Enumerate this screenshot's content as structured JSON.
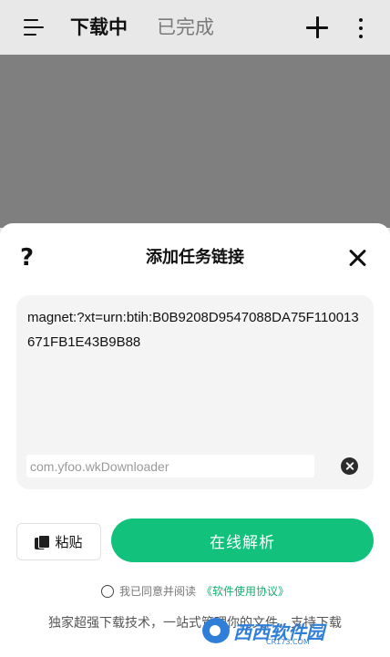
{
  "app_bar": {
    "tabs": [
      {
        "label": "下载中",
        "active": true
      },
      {
        "label": "已完成",
        "active": false
      }
    ]
  },
  "dialog": {
    "help_label": "?",
    "title": "添加任务链接",
    "link_value": "magnet:?xt=urn:btih:B0B9208D9547088DA75F110013671FB1E43B9B88",
    "package_value": "com.yfoo.wkDownloader",
    "paste_label": "粘贴",
    "parse_label": "在线解析",
    "agreement_text": "我已同意并阅读",
    "agreement_link": "《软件使用协议》",
    "footer_text": "独家超强下载技术，一站式管理你的文件，支持下载"
  },
  "watermark": {
    "brand": "西西软件园",
    "domain": "CR173.COM"
  },
  "colors": {
    "accent": "#12c17c",
    "overlay": "#7f7f7f"
  }
}
